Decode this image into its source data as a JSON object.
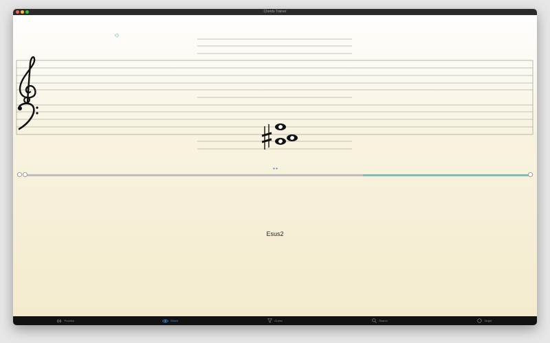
{
  "window": {
    "title": "Chords Trainer"
  },
  "chord": {
    "name": "Esus2"
  },
  "progress": {
    "fraction": 0.67
  },
  "icons": {
    "speaker": "speaker-icon",
    "treble": "treble-clef-icon",
    "bass": "bass-clef-icon",
    "sharp": "sharp-icon"
  },
  "colors": {
    "accent": "#3b8cf0",
    "progress_fill": "#7bbdb3",
    "tabbar_bg": "#121212"
  },
  "tabs": [
    {
      "label": "Practice",
      "icon": "waveform-icon",
      "active": false
    },
    {
      "label": "Watch",
      "icon": "eye-icon",
      "active": true
    },
    {
      "label": "Guess",
      "icon": "funnel-icon",
      "active": false
    },
    {
      "label": "Search",
      "icon": "search-icon",
      "active": false
    },
    {
      "label": "Target",
      "icon": "target-icon",
      "active": false
    }
  ]
}
